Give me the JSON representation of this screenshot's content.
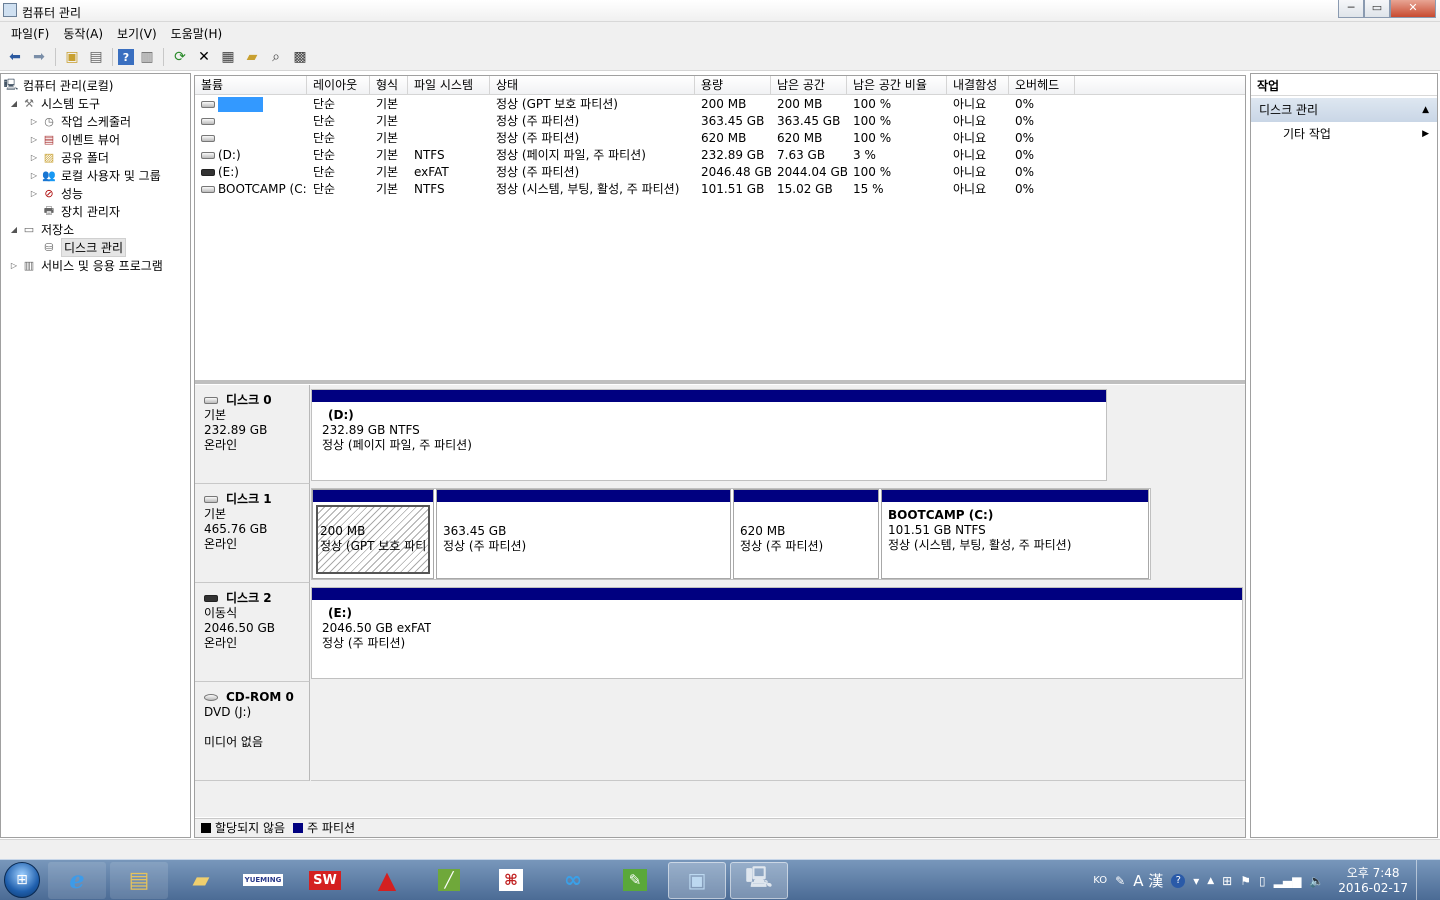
{
  "window": {
    "title": "컴퓨터 관리",
    "controls": [
      "─",
      "▭",
      "✕"
    ]
  },
  "menu": [
    "파일(F)",
    "동작(A)",
    "보기(V)",
    "도움말(H)"
  ],
  "toolbar_icons": [
    "back-icon",
    "forward-icon",
    "up-icon",
    "show-hide-tree-icon",
    "help-icon",
    "show-hide-action-icon",
    "refresh-icon",
    "delete-icon",
    "properties-icon",
    "open-icon",
    "search-icon",
    "settings-icon"
  ],
  "tree": {
    "root": "컴퓨터 관리(로컬)",
    "system_tools": "시스템 도구",
    "task_scheduler": "작업 스케줄러",
    "event_viewer": "이벤트 뷰어",
    "shared_folders": "공유 폴더",
    "local_users": "로컬 사용자 및 그룹",
    "performance": "성능",
    "device_manager": "장치 관리자",
    "storage": "저장소",
    "disk_management": "디스크 관리",
    "services": "서비스 및 응용 프로그램"
  },
  "volume_list": {
    "headers": [
      "볼륨",
      "레이아웃",
      "형식",
      "파일 시스템",
      "상태",
      "용량",
      "남은 공간",
      "남은 공간 비율",
      "내결함성",
      "오버헤드"
    ],
    "rows": [
      [
        "",
        "단순",
        "기본",
        "",
        "정상 (GPT 보호 파티션)",
        "200 MB",
        "200 MB",
        "100 %",
        "아니요",
        "0%"
      ],
      [
        "",
        "단순",
        "기본",
        "",
        "정상 (주 파티션)",
        "363.45 GB",
        "363.45 GB",
        "100 %",
        "아니요",
        "0%"
      ],
      [
        "",
        "단순",
        "기본",
        "",
        "정상 (주 파티션)",
        "620 MB",
        "620 MB",
        "100 %",
        "아니요",
        "0%"
      ],
      [
        "(D:)",
        "단순",
        "기본",
        "NTFS",
        "정상 (페이지 파일, 주 파티션)",
        "232.89 GB",
        "7.63 GB",
        "3 %",
        "아니요",
        "0%"
      ],
      [
        "(E:)",
        "단순",
        "기본",
        "exFAT",
        "정상 (주 파티션)",
        "2046.48 GB",
        "2044.04 GB",
        "100 %",
        "아니요",
        "0%"
      ],
      [
        "BOOTCAMP (C:)",
        "단순",
        "기본",
        "NTFS",
        "정상 (시스템, 부팅, 활성, 주 파티션)",
        "101.51 GB",
        "15.02 GB",
        "15 %",
        "아니요",
        "0%"
      ]
    ]
  },
  "disks": {
    "d0": {
      "name": "디스크 0",
      "type": "기본",
      "size": "232.89 GB",
      "status": "온라인",
      "p0": {
        "title": "(D:)",
        "l1": "232.89 GB NTFS",
        "l2": "정상 (페이지 파일, 주 파티션)"
      }
    },
    "d1": {
      "name": "디스크 1",
      "type": "기본",
      "size": "465.76 GB",
      "status": "온라인",
      "p0": {
        "l1": "200 MB",
        "l2": "정상 (GPT 보호 파티"
      },
      "p1": {
        "l1": "363.45 GB",
        "l2": "정상 (주 파티션)"
      },
      "p2": {
        "l1": "620 MB",
        "l2": "정상 (주 파티션)"
      },
      "p3": {
        "title": "BOOTCAMP  (C:)",
        "l1": "101.51 GB NTFS",
        "l2": "정상 (시스템, 부팅, 활성, 주 파티션)"
      }
    },
    "d2": {
      "name": "디스크 2",
      "type": "이동식",
      "size": "2046.50 GB",
      "status": "온라인",
      "p0": {
        "title": "(E:)",
        "l1": "2046.50 GB exFAT",
        "l2": "정상 (주 파티션)"
      }
    },
    "cd": {
      "name": "CD-ROM 0",
      "type": "DVD (J:)",
      "status": "미디어 없음"
    }
  },
  "legend": {
    "unallocated": "할당되지 않음",
    "primary": "주 파티션"
  },
  "colors": {
    "primary_partition": "#000080",
    "unallocated": "#000000",
    "selection": "#3399ff"
  },
  "actions": {
    "header": "작업",
    "section": "디스크 관리",
    "more": "기타 작업"
  },
  "taskbar": {
    "apps": [
      "ie-icon",
      "file-explorer-icon",
      "folder-icon",
      "yueming-icon",
      "solidworks-icon",
      "autocad-icon",
      "app-icon",
      "app2-icon",
      "baidu-icon",
      "evernote-icon",
      "control-panel-icon",
      "computer-management-icon"
    ],
    "yueming_label": "YUEMING",
    "sw_label": "SW",
    "tray": {
      "lang": "KO",
      "ime": "A 漢"
    },
    "clock": {
      "time": "오후 7:48",
      "date": "2016-02-17"
    }
  }
}
